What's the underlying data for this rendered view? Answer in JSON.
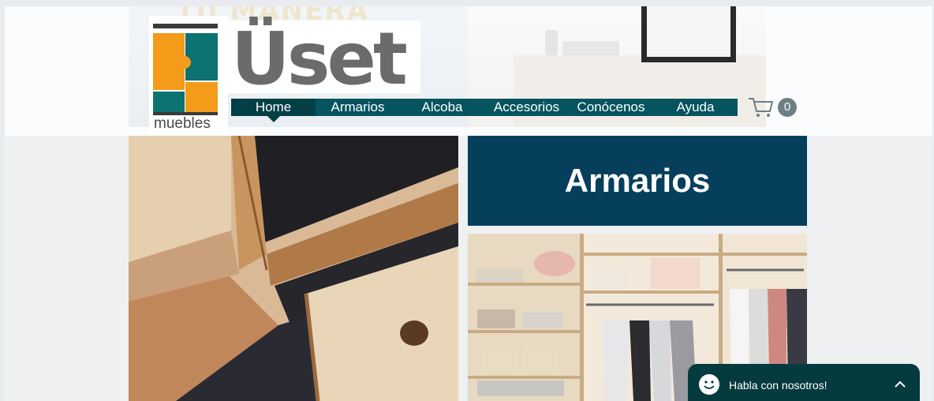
{
  "brand": {
    "logo_word": "muebles",
    "name": "Üset",
    "faint_banner_text": "TU MANERA"
  },
  "nav": {
    "items": [
      {
        "label": "Home",
        "active": true
      },
      {
        "label": "Armarios",
        "active": false
      },
      {
        "label": "Alcoba",
        "active": false
      },
      {
        "label": "Accesorios",
        "active": false
      },
      {
        "label": "Conócenos",
        "active": false
      },
      {
        "label": "Ayuda",
        "active": false
      }
    ]
  },
  "cart": {
    "count": "0",
    "icon": "cart-icon"
  },
  "feature": {
    "title": "Armarios"
  },
  "chat": {
    "label": "Habla con nosotros!",
    "icon": "smiley-icon",
    "toggle_icon": "chevron-up-icon"
  },
  "colors": {
    "nav_bg": "#06545f",
    "nav_active": "#034046",
    "panel": "#053f5c",
    "chat_bg": "#053a3f",
    "logo_orange": "#f49b1a",
    "logo_teal": "#0d7272"
  }
}
